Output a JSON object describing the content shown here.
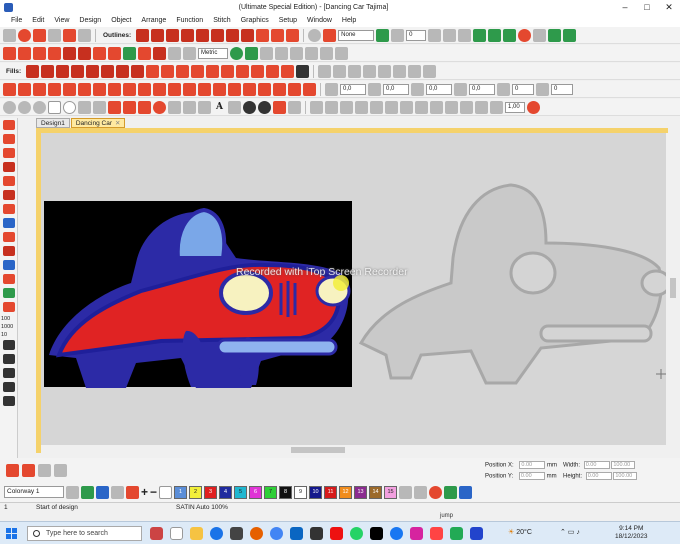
{
  "window": {
    "title": "(Ultimate Special Edition) - [Dancing Car      Tajima]"
  },
  "menu": [
    "File",
    "Edit",
    "View",
    "Design",
    "Object",
    "Arrange",
    "Function",
    "Stitch",
    "Graphics",
    "Setup",
    "Window",
    "Help"
  ],
  "toolbars": {
    "outlines_label": "Outlines:",
    "fills_label": "Fills:",
    "none_label": "None",
    "units_label": "Metric",
    "zoom_value": "1,00",
    "numeric_fields": [
      "0",
      "0",
      "0,0",
      "0,0",
      "0,0",
      "0,0",
      "0",
      "0"
    ],
    "text_3d": "3D",
    "text_A": "A"
  },
  "tabs": [
    {
      "label": "Design1",
      "active": false
    },
    {
      "label": "Dancing Car",
      "active": true
    }
  ],
  "left_toolbar_labels": [
    "100",
    "1000",
    "10"
  ],
  "canvas": {
    "watermark": "Recorded with iTop Screen Recorder"
  },
  "colorway": {
    "selected": "Colorway 1"
  },
  "palette": [
    {
      "n": "1",
      "color": "#5b8ed8"
    },
    {
      "n": "2",
      "color": "#f2ef3a"
    },
    {
      "n": "3",
      "color": "#e02020"
    },
    {
      "n": "4",
      "color": "#1f2a9e"
    },
    {
      "n": "5",
      "color": "#20b7d0"
    },
    {
      "n": "6",
      "color": "#e034d6"
    },
    {
      "n": "7",
      "color": "#2fcf37"
    },
    {
      "n": "8",
      "color": "#111111"
    },
    {
      "n": "9",
      "color": "#ffffff"
    },
    {
      "n": "10",
      "color": "#14188c"
    },
    {
      "n": "11",
      "color": "#d61b1b"
    },
    {
      "n": "12",
      "color": "#f08c1c"
    },
    {
      "n": "13",
      "color": "#8a2b8f"
    },
    {
      "n": "14",
      "color": "#9c6a2a"
    },
    {
      "n": "15",
      "color": "#f3a0e0"
    }
  ],
  "position_panel": {
    "pos_x_label": "Position X:",
    "pos_y_label": "Position Y:",
    "width_label": "Width:",
    "height_label": "Height:",
    "pos_x": "0.00",
    "pos_y": "0.00",
    "width": "0.00",
    "height": "0.00",
    "unit": "mm",
    "pct_w": "100.00",
    "pct_h": "100.00"
  },
  "status": {
    "left": "1",
    "message": "Start of design",
    "stitch": "SATIN Auto 100%"
  },
  "taskbar": {
    "search_placeholder": "Type here to search",
    "jump": "jump",
    "temperature": "20°C",
    "time": "9:14 PM",
    "date": "18/12/2023"
  }
}
